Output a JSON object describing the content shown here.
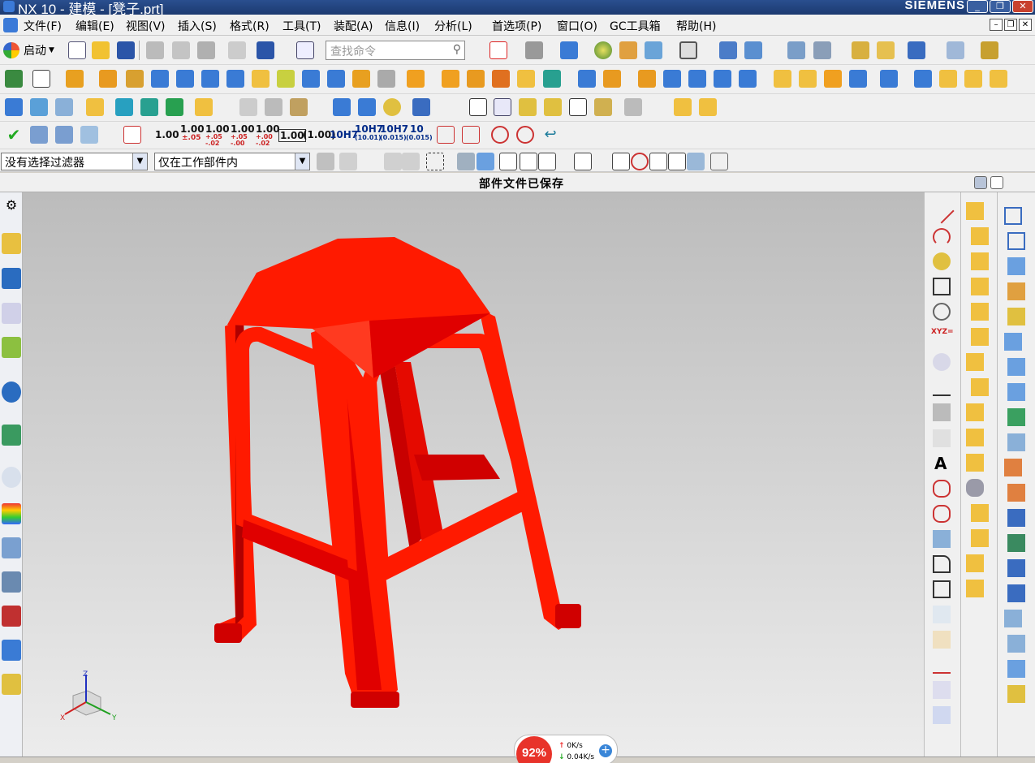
{
  "window": {
    "title": "NX 10 - 建模 - [凳子.prt]",
    "brand": "SIEMENS",
    "controls": {
      "minimize": "_",
      "maximize": "❐",
      "close": "✕"
    }
  },
  "menubar": {
    "items": [
      "文件(F)",
      "编辑(E)",
      "视图(V)",
      "插入(S)",
      "格式(R)",
      "工具(T)",
      "装配(A)",
      "信息(I)",
      "分析(L)",
      "首选项(P)",
      "窗口(O)",
      "GC工具箱",
      "帮助(H)"
    ],
    "mdi_controls": [
      "–",
      "❐",
      "✕"
    ]
  },
  "toolbar": {
    "start_label": "启动",
    "search_placeholder": "查找命令",
    "dimension_labels": [
      "1.00",
      "1.00",
      "1.00",
      "1.00",
      "1.00",
      "1.00",
      "(1.00)",
      "10H7",
      "10H7",
      "10H7",
      "10",
      "10H7"
    ],
    "dimension_sublabels": [
      "±.05",
      "+.05 -.02",
      "+.05 -.00",
      "+.00 -.02",
      "(10.01)",
      "(0.015)",
      "(0.015)"
    ]
  },
  "filter_bar": {
    "selection_filter": "没有选择过滤器",
    "scope_filter": "仅在工作部件内"
  },
  "status": {
    "message": "部件文件已保存"
  },
  "viewport": {
    "model_color": "#ff1a00",
    "triad": {
      "x": "X",
      "y": "Y",
      "z": "Z"
    }
  },
  "network_widget": {
    "percent": "92%",
    "upload": "0K/s",
    "download": "0.04K/s",
    "plus": "+"
  },
  "colors": {
    "accent": "#2a4f8f",
    "model": "#ff1a00"
  }
}
